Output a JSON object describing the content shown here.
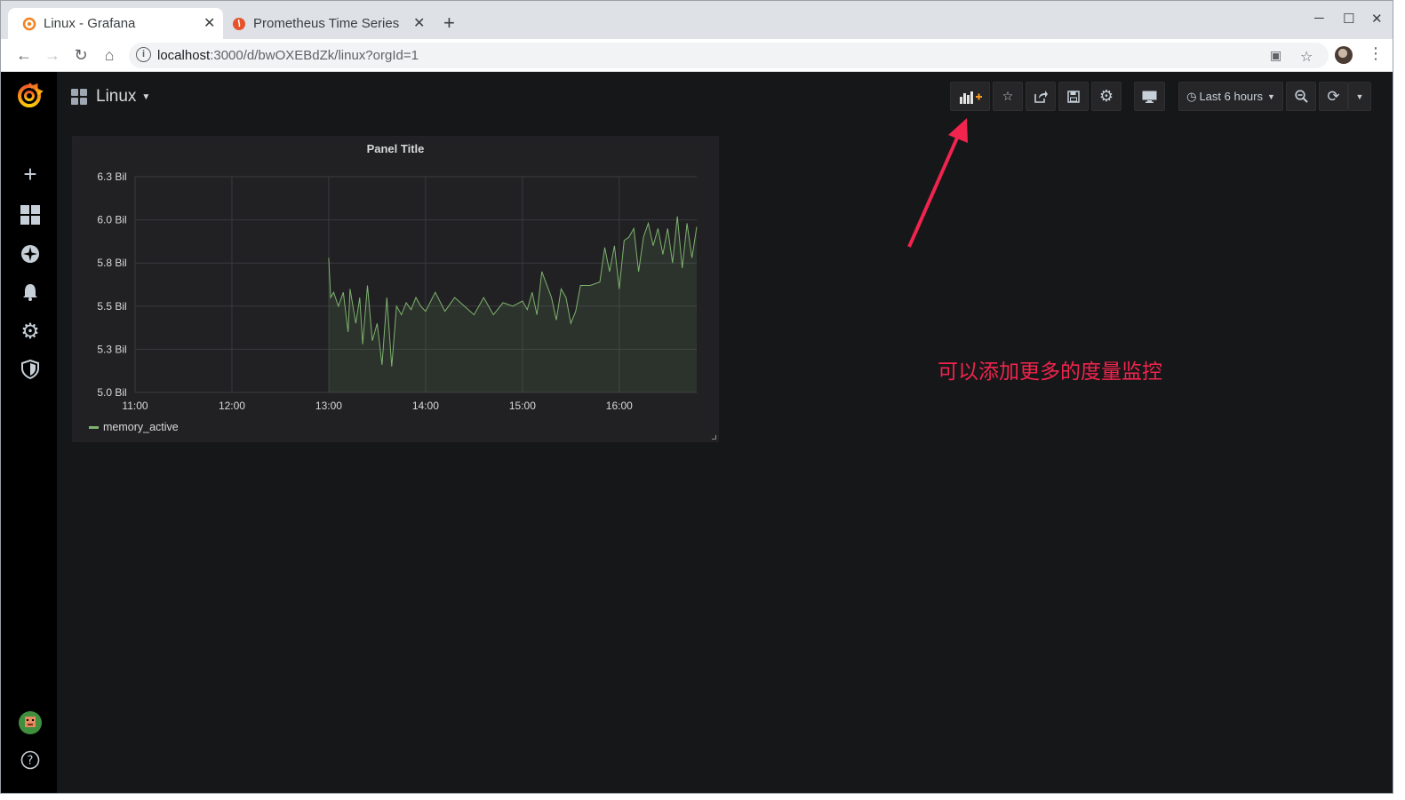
{
  "browser": {
    "tabs": [
      {
        "title": "Linux - Grafana",
        "active": true
      },
      {
        "title": "Prometheus Time Series C",
        "active": false
      }
    ],
    "url_host": "localhost",
    "url_path": ":3000/d/bwOXEBdZk/linux?orgId=1"
  },
  "dashboard": {
    "title": "Linux",
    "time_range": "Last 6 hours",
    "toolbar_icons": [
      "add-panel-icon",
      "star-icon",
      "share-icon",
      "save-icon",
      "settings-icon",
      "tv-mode-icon",
      "clock-icon",
      "zoom-out-icon",
      "refresh-icon"
    ]
  },
  "sidemenu": {
    "icons": [
      "grafana-logo",
      "plus-icon",
      "dashboards-icon",
      "explore-compass-icon",
      "alert-bell-icon",
      "configuration-gear-icon",
      "shield-icon",
      "user-avatar",
      "help-icon"
    ]
  },
  "panel": {
    "title": "Panel Title",
    "legend": "memory_active"
  },
  "annotation": {
    "text": "可以添加更多的度量监控",
    "color": "#f0244d"
  },
  "chart_data": {
    "type": "area",
    "title": "Panel Title",
    "series": [
      {
        "name": "memory_active",
        "color": "#7eb26d"
      }
    ],
    "x_ticks": [
      "11:00",
      "12:00",
      "13:00",
      "14:00",
      "15:00",
      "16:00"
    ],
    "y_ticks": [
      "5.0 Bil",
      "5.3 Bil",
      "5.5 Bil",
      "5.8 Bil",
      "6.0 Bil",
      "6.3 Bil"
    ],
    "ylim": [
      5.0,
      6.25
    ],
    "grid": true,
    "legend_position": "bottom-left",
    "x_hours": [
      13.0,
      13.02,
      13.05,
      13.1,
      13.15,
      13.2,
      13.22,
      13.28,
      13.32,
      13.35,
      13.4,
      13.45,
      13.5,
      13.55,
      13.6,
      13.65,
      13.7,
      13.75,
      13.8,
      13.85,
      13.9,
      13.95,
      14.0,
      14.1,
      14.2,
      14.3,
      14.4,
      14.5,
      14.6,
      14.7,
      14.8,
      14.9,
      15.0,
      15.05,
      15.1,
      15.15,
      15.2,
      15.3,
      15.35,
      15.4,
      15.45,
      15.5,
      15.55,
      15.6,
      15.7,
      15.8,
      15.85,
      15.9,
      15.95,
      16.0,
      16.05,
      16.1,
      16.15,
      16.2,
      16.25,
      16.3,
      16.35,
      16.4,
      16.45,
      16.5,
      16.55,
      16.6,
      16.65,
      16.7,
      16.75,
      16.8
    ],
    "values": [
      5.78,
      5.55,
      5.58,
      5.5,
      5.58,
      5.35,
      5.6,
      5.4,
      5.55,
      5.28,
      5.62,
      5.3,
      5.4,
      5.16,
      5.55,
      5.15,
      5.5,
      5.45,
      5.52,
      5.48,
      5.55,
      5.5,
      5.47,
      5.58,
      5.47,
      5.55,
      5.5,
      5.45,
      5.55,
      5.45,
      5.52,
      5.5,
      5.53,
      5.48,
      5.58,
      5.45,
      5.7,
      5.55,
      5.42,
      5.6,
      5.55,
      5.4,
      5.47,
      5.62,
      5.62,
      5.64,
      5.84,
      5.7,
      5.85,
      5.6,
      5.88,
      5.9,
      5.95,
      5.7,
      5.9,
      5.98,
      5.85,
      5.95,
      5.8,
      5.95,
      5.75,
      6.02,
      5.72,
      5.98,
      5.78,
      5.96
    ]
  }
}
